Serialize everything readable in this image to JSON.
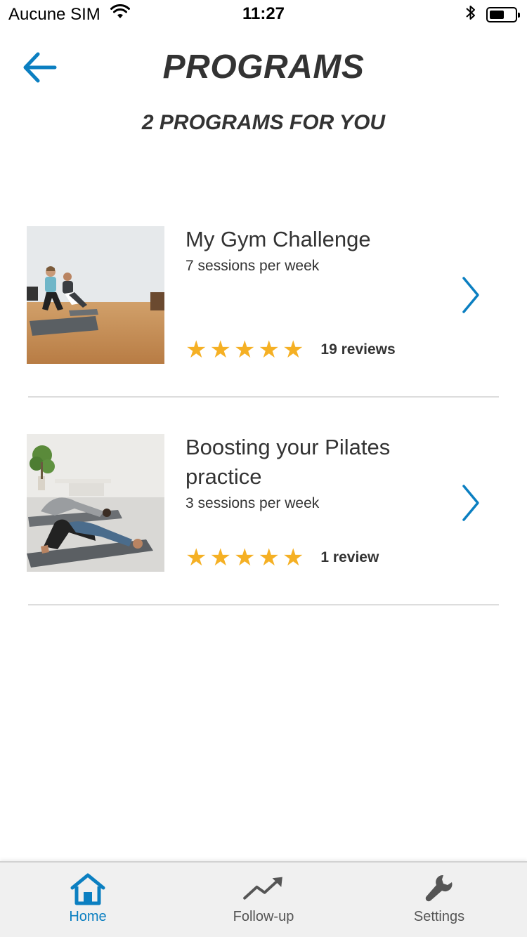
{
  "status_bar": {
    "carrier": "Aucune SIM",
    "time": "11:27"
  },
  "header": {
    "title": "PROGRAMS",
    "subtitle": "2 PROGRAMS FOR YOU"
  },
  "programs": [
    {
      "title": "My Gym Challenge",
      "sessions": "7 sessions per week",
      "rating": 5,
      "reviews": "19 reviews",
      "image": "couple-doing-crunches-photo"
    },
    {
      "title": "Boosting your Pilates practice",
      "sessions": "3 sessions per week",
      "rating": 5,
      "reviews": "1 review",
      "image": "couple-doing-pilates-bridge-photo"
    }
  ],
  "tab_bar": {
    "items": [
      {
        "label": "Home",
        "icon": "home-icon",
        "active": true
      },
      {
        "label": "Follow-up",
        "icon": "trend-up-icon",
        "active": false
      },
      {
        "label": "Settings",
        "icon": "wrench-icon",
        "active": false
      }
    ]
  },
  "colors": {
    "accent": "#0B7FC1",
    "star": "#F5B024",
    "text": "#333333",
    "tab_bar_bg": "#F0F0F0"
  }
}
